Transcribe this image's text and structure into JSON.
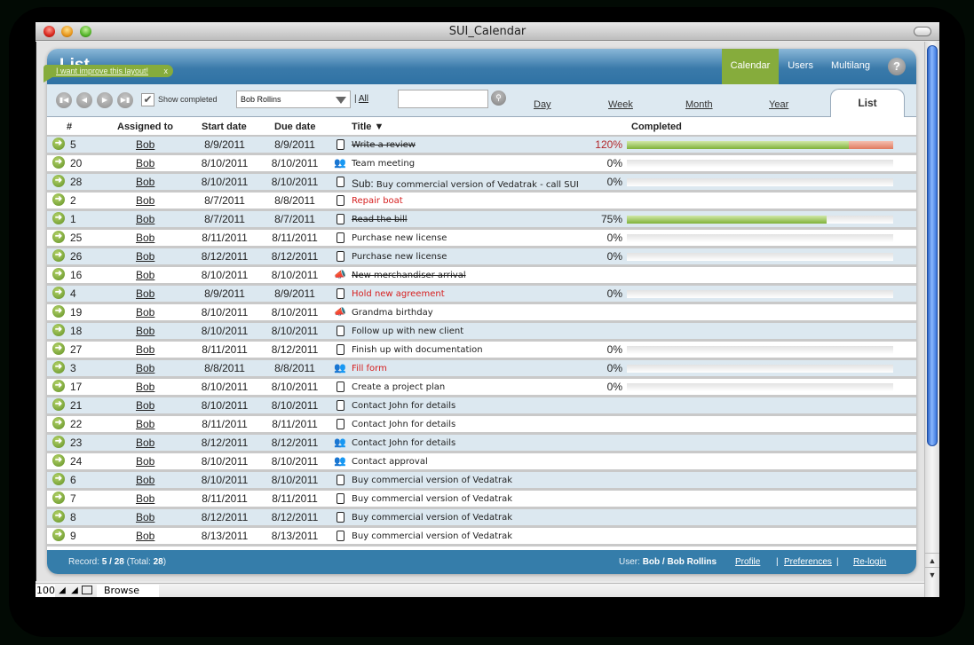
{
  "window": {
    "title": "SUI_Calendar"
  },
  "tip": {
    "label": "I want improve this layout!",
    "close": "x"
  },
  "header": {
    "title": "List",
    "nav": [
      {
        "label": "Calendar",
        "active": true
      },
      {
        "label": "Users",
        "active": false
      },
      {
        "label": "Multilang",
        "active": false
      }
    ],
    "help": "?"
  },
  "toolbar": {
    "first_icon": "first-record-icon",
    "prev_icon": "previous-record-icon",
    "next_icon": "next-record-icon",
    "last_icon": "last-record-icon",
    "show_completed_label": "Show completed",
    "show_completed_checked": true,
    "user_select_value": "Bob Rollins",
    "separator": "|",
    "all_link": "All",
    "search_value": "",
    "search_placeholder": "",
    "view_tabs": [
      "Day",
      "Week",
      "Month",
      "Year",
      "List"
    ],
    "active_view": "List"
  },
  "table": {
    "columns": {
      "num": "#",
      "assigned": "Assigned to",
      "start": "Start date",
      "due": "Due date",
      "title": "Title ▼",
      "completed": "Completed"
    },
    "rows": [
      {
        "num": "5",
        "assigned": "Bob",
        "start": "8/9/2011",
        "due": "8/9/2011",
        "type": "task",
        "title": "Write a review",
        "style": "done",
        "pct": "120%",
        "progress": 120
      },
      {
        "num": "20",
        "assigned": "Bob",
        "start": "8/10/2011",
        "due": "8/10/2011",
        "type": "meeting",
        "title": "Team meeting",
        "style": "normal",
        "pct": "0%",
        "progress": 0
      },
      {
        "num": "28",
        "assigned": "Bob",
        "start": "8/10/2011",
        "due": "8/10/2011",
        "type": "task",
        "prefix": "Sub:",
        "title": "Buy commercial version of Vedatrak - call SUI",
        "style": "normal",
        "pct": "0%",
        "progress": 0
      },
      {
        "num": "2",
        "assigned": "Bob",
        "start": "8/7/2011",
        "due": "8/8/2011",
        "type": "task",
        "title": "Repair boat",
        "style": "overdue",
        "pct": "",
        "progress": null
      },
      {
        "num": "1",
        "assigned": "Bob",
        "start": "8/7/2011",
        "due": "8/7/2011",
        "type": "task",
        "title": "Read the bill",
        "style": "done",
        "pct": "75%",
        "progress": 75
      },
      {
        "num": "25",
        "assigned": "Bob",
        "start": "8/11/2011",
        "due": "8/11/2011",
        "type": "task",
        "title": "Purchase new license",
        "style": "normal",
        "pct": "0%",
        "progress": 0
      },
      {
        "num": "26",
        "assigned": "Bob",
        "start": "8/12/2011",
        "due": "8/12/2011",
        "type": "task",
        "title": "Purchase new license",
        "style": "normal",
        "pct": "0%",
        "progress": 0
      },
      {
        "num": "16",
        "assigned": "Bob",
        "start": "8/10/2011",
        "due": "8/10/2011",
        "type": "event",
        "title": "New merchandiser arrival",
        "style": "done",
        "pct": "",
        "progress": null
      },
      {
        "num": "4",
        "assigned": "Bob",
        "start": "8/9/2011",
        "due": "8/9/2011",
        "type": "task",
        "title": "Hold new agreement",
        "style": "overdue",
        "pct": "0%",
        "progress": 0
      },
      {
        "num": "19",
        "assigned": "Bob",
        "start": "8/10/2011",
        "due": "8/10/2011",
        "type": "event",
        "title": "Grandma birthday",
        "style": "normal",
        "pct": "",
        "progress": null
      },
      {
        "num": "18",
        "assigned": "Bob",
        "start": "8/10/2011",
        "due": "8/10/2011",
        "type": "task",
        "title": "Follow up with new client",
        "style": "normal",
        "pct": "",
        "progress": null
      },
      {
        "num": "27",
        "assigned": "Bob",
        "start": "8/11/2011",
        "due": "8/12/2011",
        "type": "task",
        "title": "Finish up with documentation",
        "style": "normal",
        "pct": "0%",
        "progress": 0
      },
      {
        "num": "3",
        "assigned": "Bob",
        "start": "8/8/2011",
        "due": "8/8/2011",
        "type": "meeting",
        "title": "Fill form",
        "style": "overdue",
        "pct": "0%",
        "progress": 0
      },
      {
        "num": "17",
        "assigned": "Bob",
        "start": "8/10/2011",
        "due": "8/10/2011",
        "type": "task",
        "title": "Create a project plan",
        "style": "normal",
        "pct": "0%",
        "progress": 0
      },
      {
        "num": "21",
        "assigned": "Bob",
        "start": "8/10/2011",
        "due": "8/10/2011",
        "type": "task",
        "title": "Contact John for details",
        "style": "normal",
        "pct": "",
        "progress": null
      },
      {
        "num": "22",
        "assigned": "Bob",
        "start": "8/11/2011",
        "due": "8/11/2011",
        "type": "task",
        "title": "Contact John for details",
        "style": "normal",
        "pct": "",
        "progress": null
      },
      {
        "num": "23",
        "assigned": "Bob",
        "start": "8/12/2011",
        "due": "8/12/2011",
        "type": "meeting",
        "title": "Contact John for details",
        "style": "normal",
        "pct": "",
        "progress": null
      },
      {
        "num": "24",
        "assigned": "Bob",
        "start": "8/10/2011",
        "due": "8/10/2011",
        "type": "meeting",
        "title": "Contact approval",
        "style": "normal",
        "pct": "",
        "progress": null
      },
      {
        "num": "6",
        "assigned": "Bob",
        "start": "8/10/2011",
        "due": "8/10/2011",
        "type": "task",
        "title": "Buy commercial version of Vedatrak",
        "style": "normal",
        "pct": "",
        "progress": null
      },
      {
        "num": "7",
        "assigned": "Bob",
        "start": "8/11/2011",
        "due": "8/11/2011",
        "type": "task",
        "title": "Buy commercial version of Vedatrak",
        "style": "normal",
        "pct": "",
        "progress": null
      },
      {
        "num": "8",
        "assigned": "Bob",
        "start": "8/12/2011",
        "due": "8/12/2011",
        "type": "task",
        "title": "Buy commercial version of Vedatrak",
        "style": "normal",
        "pct": "",
        "progress": null
      },
      {
        "num": "9",
        "assigned": "Bob",
        "start": "8/13/2011",
        "due": "8/13/2011",
        "type": "task",
        "title": "Buy commercial version of Vedatrak",
        "style": "normal",
        "pct": "",
        "progress": null
      }
    ]
  },
  "footer": {
    "record_label": "Record:",
    "record_value": "5 / 28",
    "total_label": "(Total:",
    "total_value": "28",
    "total_close": ")",
    "user_label": "User:",
    "user_value": "Bob / Bob Rollins",
    "profile": "Profile",
    "preferences": "Preferences",
    "relogin": "Re-login",
    "sep": "|"
  },
  "statusbar": {
    "zoom": "100",
    "mode": "Browse"
  },
  "colors": {
    "accent_green": "#86ac3c",
    "header_blue": "#357daa",
    "row_alt": "#dce8f0",
    "overdue_red": "#d62020",
    "over_pct_red": "#b2262a"
  }
}
